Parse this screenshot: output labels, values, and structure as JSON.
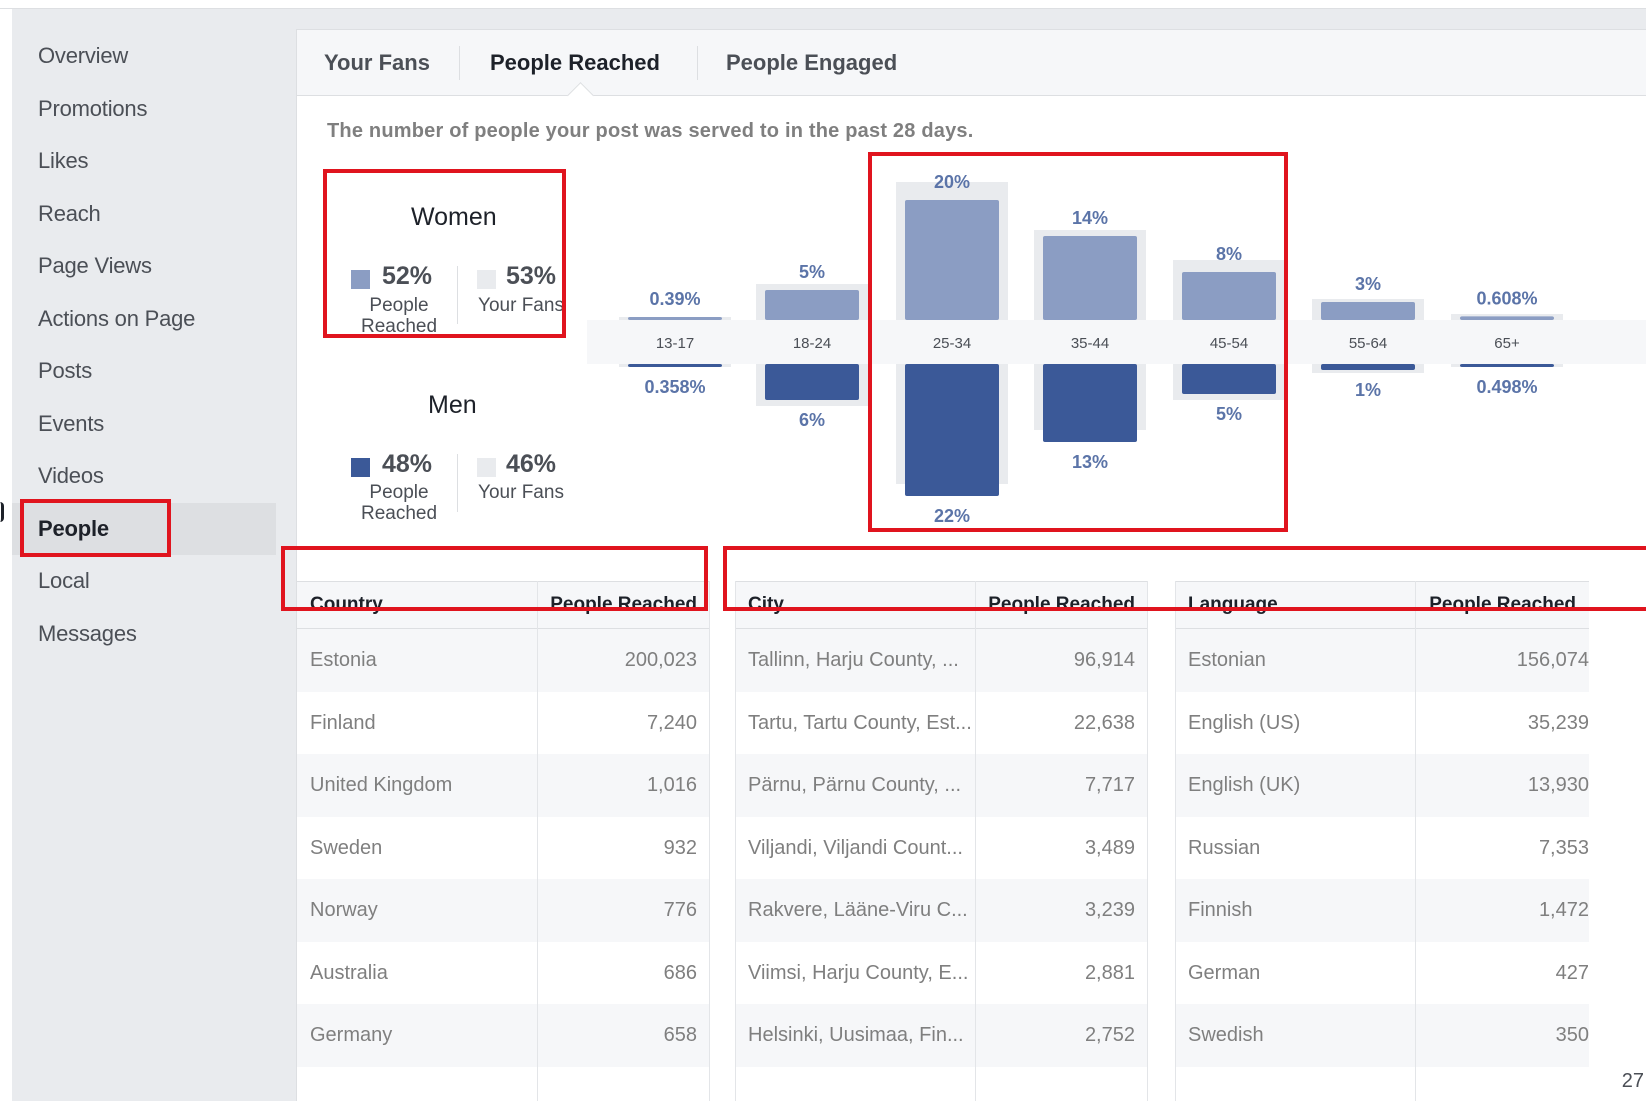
{
  "sidebar": {
    "items": [
      {
        "label": "Overview"
      },
      {
        "label": "Promotions"
      },
      {
        "label": "Likes"
      },
      {
        "label": "Reach"
      },
      {
        "label": "Page Views"
      },
      {
        "label": "Actions on Page"
      },
      {
        "label": "Posts"
      },
      {
        "label": "Events"
      },
      {
        "label": "Videos"
      },
      {
        "label": "People"
      },
      {
        "label": "Local"
      },
      {
        "label": "Messages"
      }
    ],
    "active": "People"
  },
  "tabs": [
    {
      "label": "Your Fans"
    },
    {
      "label": "People Reached"
    },
    {
      "label": "People Engaged"
    }
  ],
  "active_tab": "People Reached",
  "description": "The number of people your post was served to in the past 28 days.",
  "gender": {
    "women": {
      "title": "Women",
      "reached_pct": "52%",
      "reached_label_1": "People",
      "reached_label_2": "Reached",
      "fans_pct": "53%",
      "fans_label": "Your Fans"
    },
    "men": {
      "title": "Men",
      "reached_pct": "48%",
      "reached_label_1": "People",
      "reached_label_2": "Reached",
      "fans_pct": "46%",
      "fans_label": "Your Fans"
    }
  },
  "colors": {
    "women_bar": "#8b9dc3",
    "men_bar": "#3b5998",
    "fans_bar": "#e9ebee",
    "pct_label": "#5b74a8",
    "highlight": "#e0141e"
  },
  "chart_data": {
    "type": "bar",
    "categories": [
      "13-17",
      "18-24",
      "25-34",
      "35-44",
      "45-54",
      "55-64",
      "65+"
    ],
    "series": [
      {
        "name": "Women",
        "values": [
          0.39,
          5,
          20,
          14,
          8,
          3,
          0.608
        ],
        "labels": [
          "0.39%",
          "5%",
          "20%",
          "14%",
          "8%",
          "3%",
          "0.608%"
        ]
      },
      {
        "name": "Men",
        "values": [
          0.358,
          6,
          22,
          13,
          5,
          1,
          0.498
        ],
        "labels": [
          "0.358%",
          "6%",
          "22%",
          "13%",
          "5%",
          "1%",
          "0.498%"
        ]
      }
    ],
    "fans": {
      "women": [
        0.5,
        6,
        23,
        15,
        10,
        3.5,
        1
      ],
      "men": [
        0.3,
        7,
        20,
        11,
        6,
        1.5,
        0.4
      ]
    },
    "ylim": [
      0,
      22
    ]
  },
  "tables": {
    "country": {
      "headers": [
        "Country",
        "People Reached"
      ],
      "rows": [
        [
          "Estonia",
          "200,023"
        ],
        [
          "Finland",
          "7,240"
        ],
        [
          "United Kingdom",
          "1,016"
        ],
        [
          "Sweden",
          "932"
        ],
        [
          "Norway",
          "776"
        ],
        [
          "Australia",
          "686"
        ],
        [
          "Germany",
          "658"
        ]
      ]
    },
    "city": {
      "headers": [
        "City",
        "People Reached"
      ],
      "rows": [
        [
          "Tallinn, Harju County, ...",
          "96,914"
        ],
        [
          "Tartu, Tartu County, Est...",
          "22,638"
        ],
        [
          "Pärnu, Pärnu County, ...",
          "7,717"
        ],
        [
          "Viljandi, Viljandi Count...",
          "3,489"
        ],
        [
          "Rakvere, Lääne-Viru C...",
          "3,239"
        ],
        [
          "Viimsi, Harju County, E...",
          "2,881"
        ],
        [
          "Helsinki, Uusimaa, Fin...",
          "2,752"
        ]
      ]
    },
    "language": {
      "headers": [
        "Language",
        "People Reached"
      ],
      "rows": [
        [
          "Estonian",
          "156,074"
        ],
        [
          "English (US)",
          "35,239"
        ],
        [
          "English (UK)",
          "13,930"
        ],
        [
          "Russian",
          "7,353"
        ],
        [
          "Finnish",
          "1,472"
        ],
        [
          "German",
          "427"
        ],
        [
          "Swedish",
          "350"
        ]
      ]
    }
  },
  "page_number": "27"
}
